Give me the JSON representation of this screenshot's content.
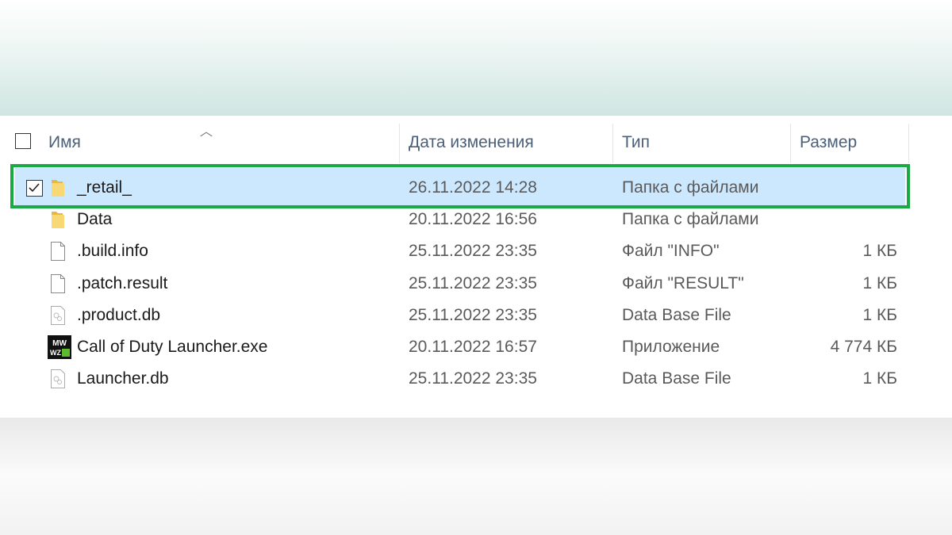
{
  "columns": {
    "name": "Имя",
    "date": "Дата изменения",
    "type": "Тип",
    "size": "Размер"
  },
  "colors": {
    "selection": "#cce8ff",
    "highlight": "#1aaa44"
  },
  "files": [
    {
      "name": "_retail_",
      "date": "26.11.2022 14:28",
      "type": "Папка с файлами",
      "size": "",
      "icon": "folder-icon",
      "selected": true
    },
    {
      "name": "Data",
      "date": "20.11.2022 16:56",
      "type": "Папка с файлами",
      "size": "",
      "icon": "folder-icon"
    },
    {
      "name": ".build.info",
      "date": "25.11.2022 23:35",
      "type": "Файл \"INFO\"",
      "size": "1 КБ",
      "icon": "file-icon"
    },
    {
      "name": ".patch.result",
      "date": "25.11.2022 23:35",
      "type": "Файл \"RESULT\"",
      "size": "1 КБ",
      "icon": "file-icon"
    },
    {
      "name": ".product.db",
      "date": "25.11.2022 23:35",
      "type": "Data Base File",
      "size": "1 КБ",
      "icon": "db-file-icon"
    },
    {
      "name": "Call of Duty Launcher.exe",
      "date": "20.11.2022 16:57",
      "type": "Приложение",
      "size": "4 774 КБ",
      "icon": "cod-app-icon"
    },
    {
      "name": "Launcher.db",
      "date": "25.11.2022 23:35",
      "type": "Data Base File",
      "size": "1 КБ",
      "icon": "db-file-icon"
    }
  ]
}
